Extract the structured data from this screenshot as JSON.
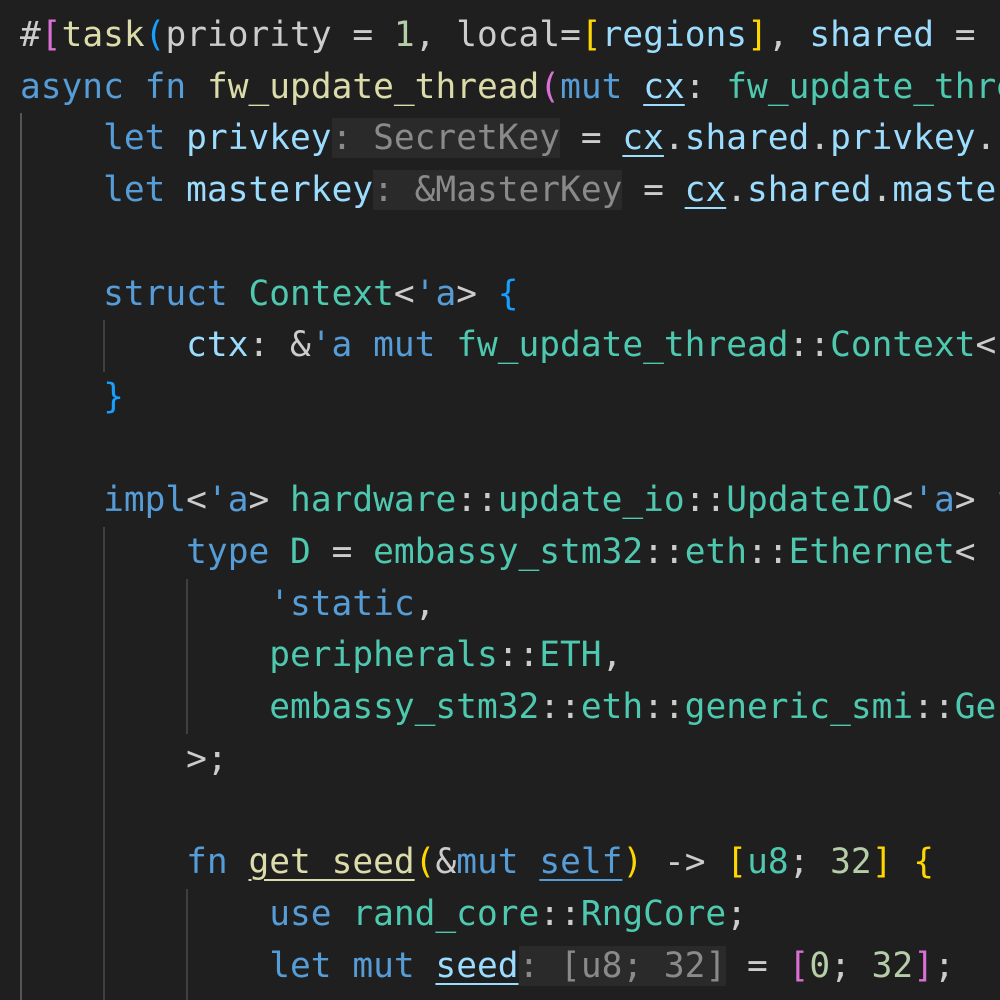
{
  "editor": {
    "language": "rust",
    "colors": {
      "background": "#1f1f1f",
      "keyword": "#569cd6",
      "function": "#dcdcaa",
      "variable": "#9cdcfe",
      "type": "#4ec9b0",
      "number": "#b5cea8",
      "inlay_hint": "#8a8a8a"
    },
    "lines": [
      {
        "indent": 0,
        "tokens": [
          [
            "#",
            "plain"
          ],
          [
            "[",
            "pink"
          ],
          [
            "task",
            "fn"
          ],
          [
            "(",
            "blue"
          ],
          [
            "priority = ",
            "plain"
          ],
          [
            "1",
            "num"
          ],
          [
            ", local=",
            "plain"
          ],
          [
            "[",
            "gold"
          ],
          [
            "regions",
            "var"
          ],
          [
            "]",
            "gold"
          ],
          [
            ", ",
            "plain"
          ],
          [
            "shared",
            "var"
          ],
          [
            " = ",
            "plain"
          ]
        ]
      },
      {
        "indent": 0,
        "tokens": [
          [
            "async",
            "kw"
          ],
          [
            " ",
            "plain"
          ],
          [
            "fn",
            "kw"
          ],
          [
            " ",
            "plain"
          ],
          [
            "fw_update_thread",
            "fn"
          ],
          [
            "(",
            "pink"
          ],
          [
            "mut",
            "kw"
          ],
          [
            " ",
            "plain"
          ],
          [
            "cx",
            "var ul"
          ],
          [
            ": ",
            "plain"
          ],
          [
            "fw_update_thre",
            "type"
          ]
        ]
      },
      {
        "indent": 4,
        "tokens": [
          [
            "let",
            "kw"
          ],
          [
            " ",
            "plain"
          ],
          [
            "privkey",
            "var"
          ],
          [
            ": SecretKey",
            "hint"
          ],
          [
            " = ",
            "plain"
          ],
          [
            "cx",
            "var ul"
          ],
          [
            ".",
            "plain"
          ],
          [
            "shared",
            "var"
          ],
          [
            ".",
            "plain"
          ],
          [
            "privkey",
            "var"
          ],
          [
            ".",
            "plain"
          ]
        ]
      },
      {
        "indent": 4,
        "tokens": [
          [
            "let",
            "kw"
          ],
          [
            " ",
            "plain"
          ],
          [
            "masterkey",
            "var"
          ],
          [
            ": &MasterKey",
            "hint"
          ],
          [
            " = ",
            "plain"
          ],
          [
            "cx",
            "var ul"
          ],
          [
            ".",
            "plain"
          ],
          [
            "shared",
            "var"
          ],
          [
            ".",
            "plain"
          ],
          [
            "master",
            "var"
          ]
        ]
      },
      {
        "indent": 0,
        "tokens": []
      },
      {
        "indent": 4,
        "tokens": [
          [
            "struct",
            "kw"
          ],
          [
            " ",
            "plain"
          ],
          [
            "Context",
            "type"
          ],
          [
            "<",
            "plain"
          ],
          [
            "'a",
            "kw"
          ],
          [
            ">",
            "plain"
          ],
          [
            " ",
            "plain"
          ],
          [
            "{",
            "blue"
          ]
        ]
      },
      {
        "indent": 8,
        "tokens": [
          [
            "ctx",
            "var"
          ],
          [
            ": &",
            "plain"
          ],
          [
            "'a",
            "kw"
          ],
          [
            " ",
            "plain"
          ],
          [
            "mut",
            "kw"
          ],
          [
            " ",
            "plain"
          ],
          [
            "fw_update_thread",
            "type"
          ],
          [
            "::",
            "plain"
          ],
          [
            "Context",
            "type"
          ],
          [
            "<",
            "plain"
          ]
        ]
      },
      {
        "indent": 4,
        "tokens": [
          [
            "}",
            "blue"
          ]
        ]
      },
      {
        "indent": 0,
        "tokens": []
      },
      {
        "indent": 4,
        "tokens": [
          [
            "impl",
            "kw"
          ],
          [
            "<",
            "plain"
          ],
          [
            "'a",
            "kw"
          ],
          [
            "> ",
            "plain"
          ],
          [
            "hardware",
            "type"
          ],
          [
            "::",
            "plain"
          ],
          [
            "update_io",
            "type"
          ],
          [
            "::",
            "plain"
          ],
          [
            "UpdateIO",
            "type"
          ],
          [
            "<",
            "plain"
          ],
          [
            "'a",
            "kw"
          ],
          [
            "> ",
            "plain"
          ],
          [
            "f",
            "kw"
          ]
        ]
      },
      {
        "indent": 8,
        "tokens": [
          [
            "type",
            "kw"
          ],
          [
            " ",
            "plain"
          ],
          [
            "D",
            "type"
          ],
          [
            " = ",
            "plain"
          ],
          [
            "embassy_stm32",
            "type"
          ],
          [
            "::",
            "plain"
          ],
          [
            "eth",
            "type"
          ],
          [
            "::",
            "plain"
          ],
          [
            "Ethernet",
            "type"
          ],
          [
            "<",
            "plain"
          ]
        ]
      },
      {
        "indent": 12,
        "tokens": [
          [
            "'static",
            "kw"
          ],
          [
            ",",
            "plain"
          ]
        ]
      },
      {
        "indent": 12,
        "tokens": [
          [
            "peripherals",
            "type"
          ],
          [
            "::",
            "plain"
          ],
          [
            "ETH",
            "type"
          ],
          [
            ",",
            "plain"
          ]
        ]
      },
      {
        "indent": 12,
        "tokens": [
          [
            "embassy_stm32",
            "type"
          ],
          [
            "::",
            "plain"
          ],
          [
            "eth",
            "type"
          ],
          [
            "::",
            "plain"
          ],
          [
            "generic_smi",
            "type"
          ],
          [
            "::",
            "plain"
          ],
          [
            "Ge",
            "type"
          ]
        ]
      },
      {
        "indent": 8,
        "tokens": [
          [
            ">;",
            "plain"
          ]
        ]
      },
      {
        "indent": 0,
        "tokens": []
      },
      {
        "indent": 8,
        "tokens": [
          [
            "fn",
            "kw"
          ],
          [
            " ",
            "plain"
          ],
          [
            "get_seed",
            "fn ul"
          ],
          [
            "(",
            "gold"
          ],
          [
            "&",
            "plain"
          ],
          [
            "mut",
            "kw"
          ],
          [
            " ",
            "plain"
          ],
          [
            "self",
            "kw ul"
          ],
          [
            ")",
            "gold"
          ],
          [
            " -> ",
            "plain"
          ],
          [
            "[",
            "gold"
          ],
          [
            "u8",
            "type"
          ],
          [
            "; ",
            "plain"
          ],
          [
            "32",
            "num"
          ],
          [
            "]",
            "gold"
          ],
          [
            " ",
            "plain"
          ],
          [
            "{",
            "gold"
          ]
        ]
      },
      {
        "indent": 12,
        "tokens": [
          [
            "use",
            "kw"
          ],
          [
            " ",
            "plain"
          ],
          [
            "rand_core",
            "type"
          ],
          [
            "::",
            "plain"
          ],
          [
            "RngCore",
            "type"
          ],
          [
            ";",
            "plain"
          ]
        ]
      },
      {
        "indent": 12,
        "tokens": [
          [
            "let",
            "kw"
          ],
          [
            " ",
            "plain"
          ],
          [
            "mut",
            "kw"
          ],
          [
            " ",
            "plain"
          ],
          [
            "seed",
            "var ul"
          ],
          [
            ": [u8; 32]",
            "hint"
          ],
          [
            " = ",
            "plain"
          ],
          [
            "[",
            "pink"
          ],
          [
            "0",
            "num"
          ],
          [
            "; ",
            "plain"
          ],
          [
            "32",
            "num"
          ],
          [
            "]",
            "pink"
          ],
          [
            ";",
            "plain"
          ]
        ]
      }
    ]
  }
}
